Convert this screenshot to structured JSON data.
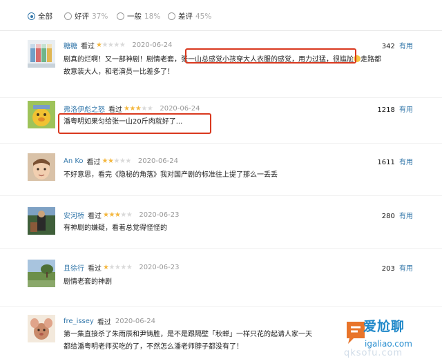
{
  "filters": [
    {
      "label": "全部",
      "pct": "",
      "checked": true
    },
    {
      "label": "好评",
      "pct": "37%",
      "checked": false
    },
    {
      "label": "一般",
      "pct": "18%",
      "checked": false
    },
    {
      "label": "差评",
      "pct": "45%",
      "checked": false
    }
  ],
  "reviews": [
    {
      "user": "糖糖",
      "watched": "看过",
      "rating": 1,
      "date": "2020-06-24",
      "votes": "342",
      "useful": "有用",
      "line1_pre": "剧真的烂啊！又一部神剧！剧情老套，",
      "line1_hl": "张一山总感觉小孩穿大人衣服的感觉，用力过猛，",
      "line1_post": "很尴尬",
      "line1_tail": "走路都",
      "line2": "故意装大人，和老演员一比差多了！"
    },
    {
      "user": "弗洛伊彪之怒",
      "watched": "看过",
      "rating": 3,
      "date": "2020-06-24",
      "votes": "1218",
      "useful": "有用",
      "line1_hl": "潘粤明如果匀给张一山20斤肉就好了..."
    },
    {
      "user": "An Ko",
      "watched": "看过",
      "rating": 2,
      "date": "2020-06-24",
      "votes": "1611",
      "useful": "有用",
      "line1": "不好意思，看完《隐秘的角落》我对国产剧的标准往上提了那么一丢丢"
    },
    {
      "user": "安河桥",
      "watched": "看过",
      "rating": 3,
      "date": "2020-06-23",
      "votes": "280",
      "useful": "有用",
      "line1": "有神剧的嫌疑，看着总觉得怪怪的"
    },
    {
      "user": "且徐行",
      "watched": "看过",
      "rating": 1,
      "date": "2020-06-23",
      "votes": "203",
      "useful": "有用",
      "line1": "剧情老套的神剧"
    },
    {
      "user": "fre_issey",
      "watched": "看过",
      "date": "2020-06-24",
      "line1": "第一集直接杀了朱雨辰和尹铸胜，是不是跟隔壁「秋蝉」一样只花的起请人家一天",
      "line2": "都给潘粤明老师买吃的了，不然怎么潘老师脖子都没有了！"
    }
  ],
  "watermark": {
    "text": "爱尬聊",
    "url": "igaliao.com",
    "ghost": "qksofu.com"
  },
  "colors": {
    "link": "#3377aa",
    "star": "#f4b73e",
    "highlight_box": "#d9381e"
  }
}
